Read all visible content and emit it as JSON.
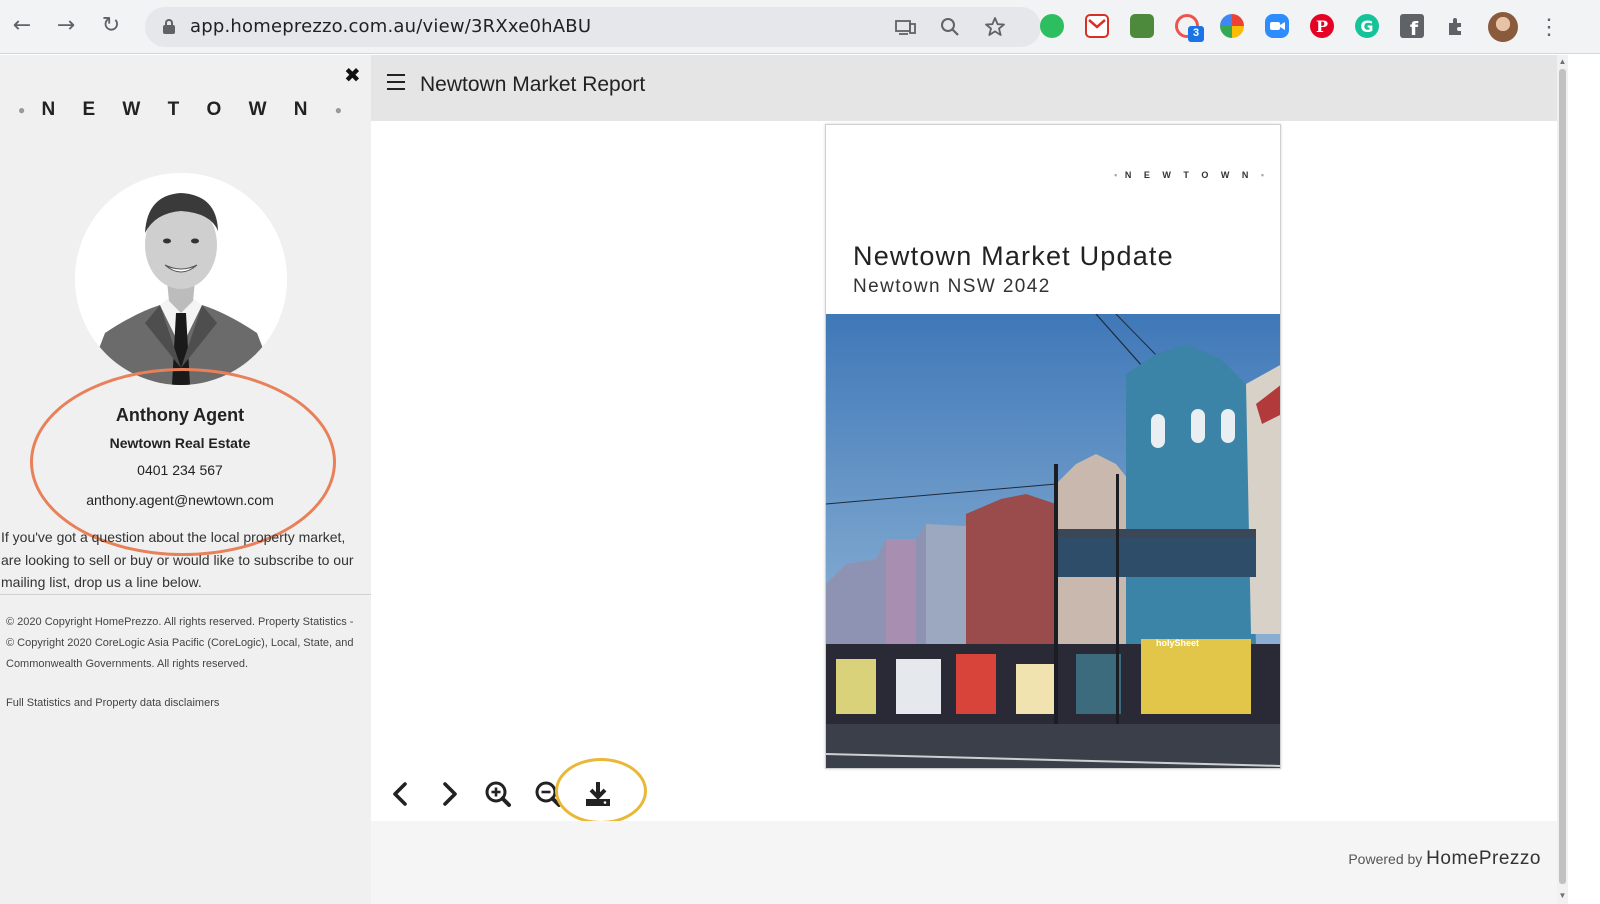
{
  "browser": {
    "url": "app.homeprezzo.com.au/view/3RXxe0hABU",
    "extension_badge": "3"
  },
  "sidebar": {
    "brand": "N E W T O W N",
    "agent": {
      "name": "Anthony Agent",
      "agency": "Newtown Real Estate",
      "phone": "0401 234 567",
      "email": "anthony.agent@newtown.com"
    },
    "blurb": "If you've got a question about the local property market, are looking to sell or buy or would like to subscribe to our mailing list, drop us a line below.",
    "copyright": "© 2020 Copyright HomePrezzo. All rights reserved. Property Statistics - © Copyright 2020 CoreLogic Asia Pacific (CoreLogic), Local, State, and Commonwealth Governments. All rights reserved.",
    "disclaimer_link": "Full Statistics and Property data disclaimers"
  },
  "main": {
    "report_title": "Newtown Market Report",
    "document": {
      "brand": "N E W T O W N",
      "title": "Newtown Market Update",
      "subtitle": "Newtown NSW 2042",
      "shop_sign": "holySheet"
    },
    "footer": {
      "powered_prefix": "Powered by",
      "powered_brand": "HomePrezzo"
    }
  },
  "colors": {
    "annotation_orange": "#e8805a",
    "annotation_yellow": "#e9b837",
    "sidebar_bg": "#f0f0f0",
    "topbar_bg": "#e5e5e5"
  },
  "icons": {
    "prev": "chevron-left-icon",
    "next": "chevron-right-icon",
    "zoom_in": "zoom-in-icon",
    "zoom_out": "zoom-out-icon",
    "download": "download-icon",
    "menu": "hamburger-icon",
    "close": "close-icon"
  }
}
